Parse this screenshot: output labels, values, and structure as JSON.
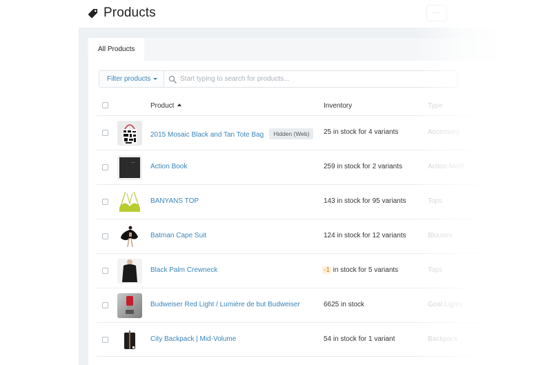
{
  "header": {
    "title": "Products",
    "title_icon": "tag-icon",
    "more_button_label": "···"
  },
  "tabs": [
    {
      "label": "All Products",
      "active": true
    }
  ],
  "filter": {
    "button_label": "Filter products",
    "search_placeholder": "Start typing to search for products...",
    "search_value": ""
  },
  "table": {
    "columns": [
      {
        "label": "Product",
        "sorted": "ascending"
      },
      {
        "label": "Inventory"
      },
      {
        "label": "Type"
      }
    ],
    "rows": [
      {
        "name": "2015 Mosaic Black and Tan Tote Bag",
        "badge": "Hidden (Web)",
        "inventory_prefix": "",
        "inventory_count": "25",
        "inventory_suffix": " in stock for 4 variants",
        "negative": false,
        "type": "Accessory",
        "thumb": "tote-bag"
      },
      {
        "name": "Action Book",
        "badge": "",
        "inventory_count": "259",
        "inventory_suffix": " in stock for 2 variants",
        "negative": false,
        "type": "Action Motif",
        "thumb": "book"
      },
      {
        "name": "BANYANS TOP",
        "badge": "",
        "inventory_count": "143",
        "inventory_suffix": " in stock for 95 variants",
        "negative": false,
        "type": "Tops",
        "thumb": "bikini-top"
      },
      {
        "name": "Batman Cape Suit",
        "badge": "",
        "inventory_count": "124",
        "inventory_suffix": " in stock for 12 variants",
        "negative": false,
        "type": "Blouses",
        "thumb": "cape-suit"
      },
      {
        "name": "Black Palm Crewneck",
        "badge": "",
        "inventory_count": "-1",
        "inventory_suffix": " in stock for 5 variants",
        "negative": true,
        "type": "Tops",
        "thumb": "crewneck"
      },
      {
        "name": "Budweiser Red Light / Lumière de but Budweiser",
        "badge": "",
        "inventory_count": "6625",
        "inventory_suffix": " in stock",
        "negative": false,
        "type": "Goal Lights",
        "thumb": "goal-light"
      },
      {
        "name": "City Backpack | Mid-Volume",
        "badge": "",
        "inventory_count": "54",
        "inventory_suffix": " in stock for 1 variant",
        "negative": false,
        "type": "Backpack",
        "thumb": "backpack"
      }
    ]
  },
  "colors": {
    "link": "#3a84b8",
    "negative_stock": "#d97e14",
    "negative_stock_bg": "#fdf1dc",
    "canvas_bg": "#eef1f4"
  }
}
